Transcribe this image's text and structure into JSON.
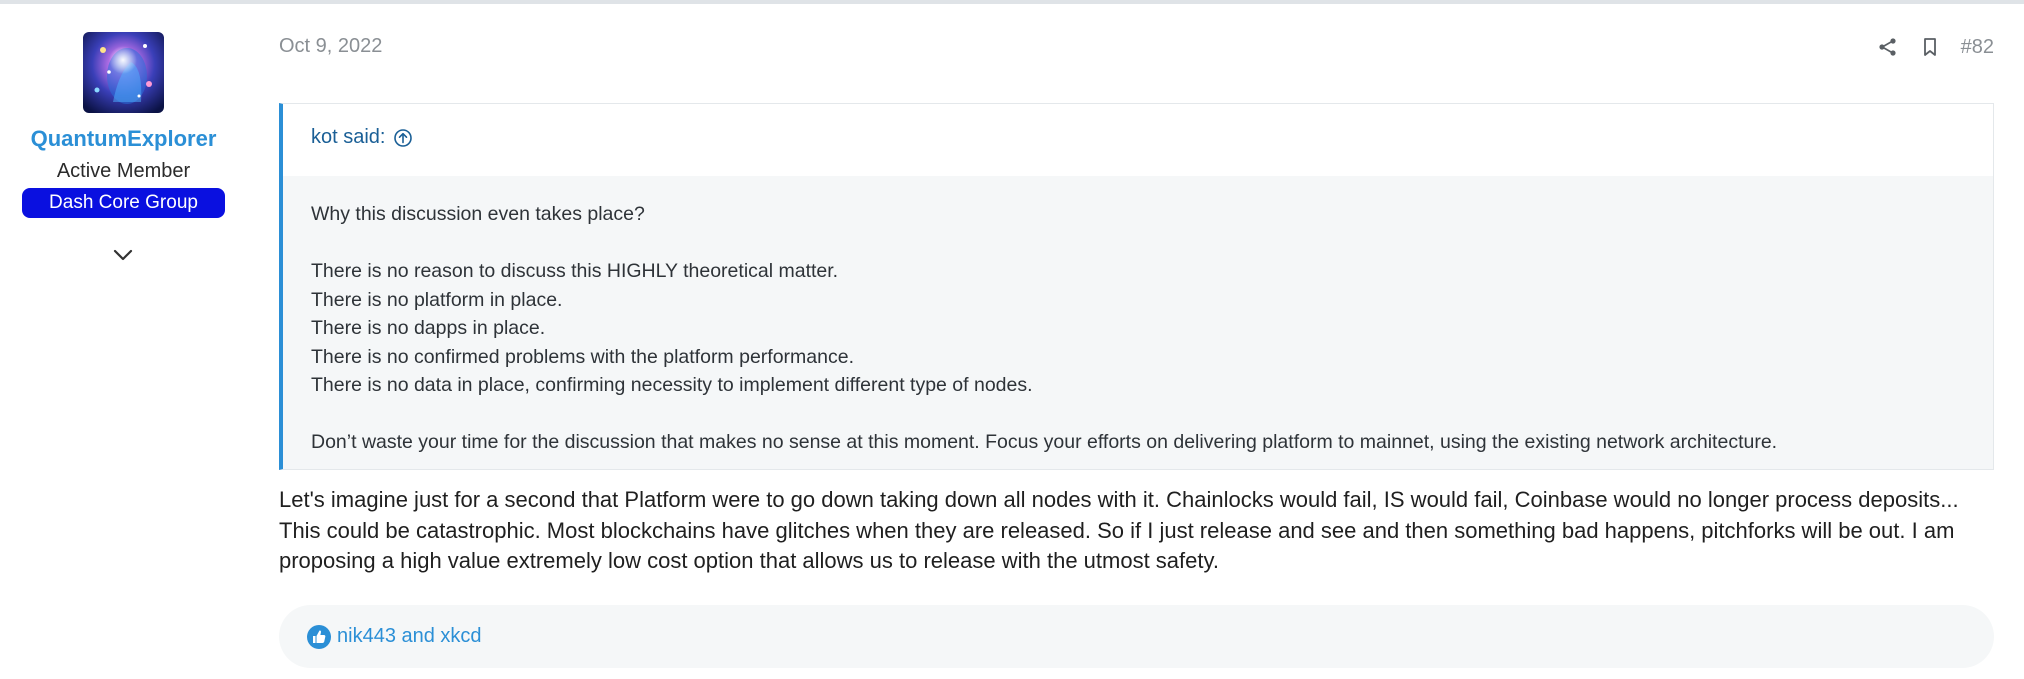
{
  "post": {
    "date": "Oct 9, 2022",
    "number": "#82",
    "author": {
      "username": "QuantumExplorer",
      "title": "Active Member",
      "banner": "Dash Core Group",
      "banner_color": "#0a10e0"
    },
    "quote": {
      "attribution": "kot said:",
      "lines": [
        "Why this discussion even takes place?",
        "",
        "There is no reason to discuss this HIGHLY theoretical matter.",
        "There is no platform in place.",
        "There is no dapps in place.",
        "There is no confirmed problems with the platform performance.",
        "There is no data in place, confirming necessity to implement different type of nodes.",
        "",
        "Don’t waste your time for the discussion that makes no sense at this moment. Focus your efforts on delivering platform to mainnet, using the existing network architecture."
      ]
    },
    "message": "Let's imagine just for a second that Platform were to go down taking down all nodes with it. Chainlocks would fail, IS would fail, Coinbase would no longer process deposits... This could be catastrophic. Most blockchains have glitches when they are released. So if I just release and see and then something bad happens, pitchforks will be out. I am proposing a high value extremely low cost option that allows us to release with the utmost safety.",
    "reactions": {
      "users": "nik443 and xkcd",
      "icon": "thumbs-up-icon"
    }
  },
  "icons": {
    "share": "share-icon",
    "bookmark": "bookmark-icon",
    "expand": "chevron-down-icon",
    "quote_jump": "arrow-up-circle-icon"
  },
  "colors": {
    "link": "#2b8fd6",
    "quote_border": "#2b8fd6",
    "quote_bg": "#f5f7f8",
    "muted": "#8a8f94"
  }
}
